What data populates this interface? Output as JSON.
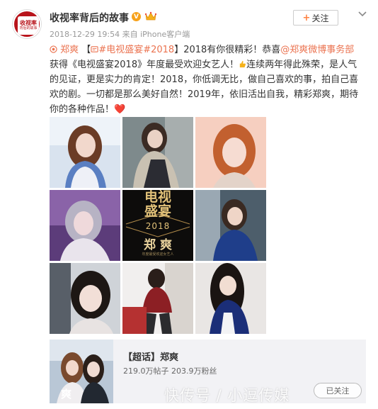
{
  "account": {
    "avatar_line1": "收视率",
    "avatar_line2": "背后的故事",
    "name": "收视率背后的故事",
    "verified_mark": "V",
    "crown_icon": "crown-icon"
  },
  "meta": {
    "timestamp": "2018-12-29 19:54",
    "source": "来自 iPhone客户端"
  },
  "follow": {
    "label": "关注",
    "plus": "+"
  },
  "post": {
    "mention_name": "郑爽",
    "hashtag": "#电视盛宴#2018",
    "bracket_open": "【",
    "bracket_close": "】",
    "seg1": "2018有你很精彩！恭喜",
    "mention2": "@郑爽微博事务部",
    "seg2": "获得《电视盛宴2018》年度最受欢迎女艺人！",
    "seg3": "连续两年得此殊荣，是人气的见证，更是实力的肯定！2018，你低调无比，做自己喜欢的事，拍自己喜欢的剧。一切都是那么美好自然！2019年，依旧活出自我，精彩郑爽，期待你的各种作品！",
    "heart": "❤️"
  },
  "photo_grid": {
    "poster_text1": "电视",
    "poster_text2": "盛宴",
    "poster_year": "2018",
    "poster_name": "郑 爽",
    "poster_caption": "年度最受欢迎女艺人"
  },
  "super_topic": {
    "tag": "【超话】",
    "name": "郑爽",
    "stats": "219.0万帖子 203.9万粉丝",
    "button": "已关注"
  },
  "watermark": "快传号 / 小逗传媒",
  "colors": {
    "link": "#eb7350",
    "brand_red": "#b8141b",
    "verified": "#f7a21b"
  }
}
